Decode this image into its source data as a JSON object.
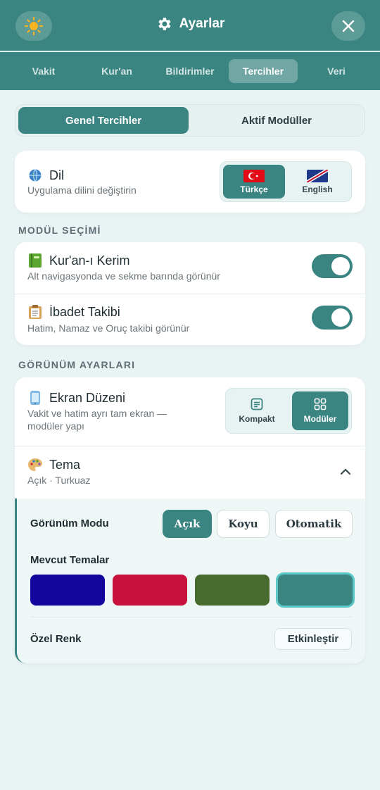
{
  "header": {
    "title": "Ayarlar",
    "left_icon": "sun-icon",
    "title_icon": "gear-icon",
    "right_icon": "close-icon"
  },
  "tabs": [
    {
      "label": "Vakit"
    },
    {
      "label": "Kur'an"
    },
    {
      "label": "Bildirimler"
    },
    {
      "label": "Tercihler",
      "active": true
    },
    {
      "label": "Veri"
    }
  ],
  "segment": {
    "general": "Genel Tercihler",
    "modules": "Aktif Modüller"
  },
  "language": {
    "title": "Dil",
    "subtitle": "Uygulama dilini değiştirin",
    "icon": "globe-icon",
    "options": [
      {
        "label": "Türkçe",
        "active": true
      },
      {
        "label": "English",
        "active": false
      }
    ]
  },
  "module_section": {
    "label": "MODÜL SEÇİMİ",
    "items": [
      {
        "title": "Kur'an-ı Kerim",
        "subtitle": "Alt navigasyonda ve sekme barında görünür",
        "icon": "book-icon",
        "enabled": true
      },
      {
        "title": "İbadet Takibi",
        "subtitle": "Hatim, Namaz ve Oruç takibi görünür",
        "icon": "clipboard-icon",
        "enabled": true
      }
    ]
  },
  "appearance_section": {
    "label": "GÖRÜNÜM AYARLARI",
    "layout": {
      "title": "Ekran Düzeni",
      "subtitle_line1": "Vakit ve hatim ayrı tam ekran —",
      "subtitle_line2": "modüler yapı",
      "icon": "phone-icon",
      "options": [
        {
          "label": "Kompakt",
          "active": false
        },
        {
          "label": "Modüler",
          "active": true
        }
      ]
    },
    "theme": {
      "title": "Tema",
      "subtitle": "Açık · Turkuaz",
      "icon": "palette-icon",
      "mode_label": "Görünüm Modu",
      "modes": [
        {
          "label": "Açık",
          "active": true
        },
        {
          "label": "Koyu",
          "active": false
        },
        {
          "label": "Otomatik",
          "active": false
        }
      ],
      "available_label": "Mevcut Temalar",
      "swatches": [
        {
          "color": "#12069f",
          "selected": false
        },
        {
          "color": "#c8113c",
          "selected": false
        },
        {
          "color": "#476a2e",
          "selected": false
        },
        {
          "color": "#3a8581",
          "selected": true
        }
      ],
      "custom_label": "Özel Renk",
      "enable_label": "Etkinleştir"
    }
  },
  "colors": {
    "primary": "#3a8581",
    "background": "#e9f3f3"
  }
}
